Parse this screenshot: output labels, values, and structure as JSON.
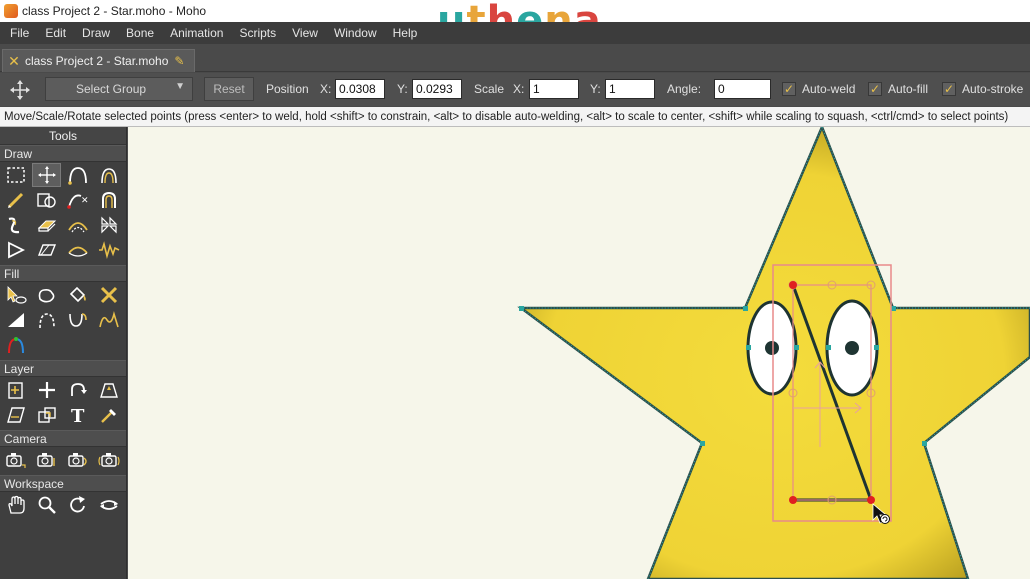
{
  "window": {
    "title": "class Project 2 - Star.moho - Moho",
    "brand": [
      {
        "ch": "u",
        "color": "#2aa6a0"
      },
      {
        "ch": "t",
        "color": "#e8a53a"
      },
      {
        "ch": "h",
        "color": "#d9453f"
      },
      {
        "ch": "e",
        "color": "#2aa6a0"
      },
      {
        "ch": "n",
        "color": "#e8a53a"
      },
      {
        "ch": "a",
        "color": "#d9453f"
      }
    ]
  },
  "menu": [
    "File",
    "Edit",
    "Draw",
    "Bone",
    "Animation",
    "Scripts",
    "View",
    "Window",
    "Help"
  ],
  "tab": {
    "label": "class Project 2 - Star.moho"
  },
  "toolbar": {
    "select_group": "Select Group",
    "reset": "Reset",
    "position_label": "Position",
    "x_label": "X:",
    "x_value": "0.0308",
    "y_label": "Y:",
    "y_value": "0.0293",
    "scale_label": "Scale",
    "scale_x_label": "X:",
    "scale_x_value": "1",
    "scale_y_label": "Y:",
    "scale_y_value": "1",
    "angle_label": "Angle:",
    "angle_value": "0",
    "auto_weld": "Auto-weld",
    "auto_fill": "Auto-fill",
    "auto_stroke": "Auto-stroke"
  },
  "status": "Move/Scale/Rotate selected points (press <enter> to weld, hold <shift> to constrain, <alt> to disable auto-welding, <alt> to scale to center, <shift> while scaling to squash, <ctrl/cmd> to select points)",
  "tools_panel": {
    "title": "Tools",
    "sections": {
      "draw": "Draw",
      "fill": "Fill",
      "layer": "Layer",
      "camera": "Camera",
      "workspace": "Workspace"
    }
  },
  "colors": {
    "star_fill": "#f2d738",
    "star_outline": "#2aa6a0",
    "selection": "#e88a8a",
    "point_selected": "#e02020",
    "accent": "#e8c04a"
  }
}
